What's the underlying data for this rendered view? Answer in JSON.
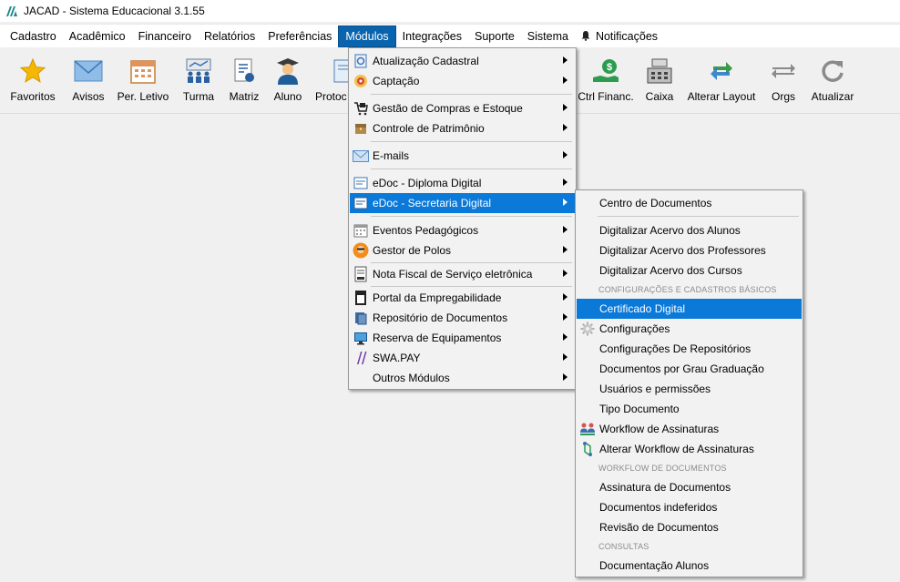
{
  "window": {
    "title": "JACAD - Sistema Educacional 3.1.55"
  },
  "menubar": {
    "items": [
      "Cadastro",
      "Acadêmico",
      "Financeiro",
      "Relatórios",
      "Preferências",
      "Módulos",
      "Integrações",
      "Suporte",
      "Sistema"
    ],
    "notifications": "Notificações"
  },
  "toolbar": {
    "items": [
      "Favoritos",
      "Avisos",
      "Per. Letivo",
      "Turma",
      "Matriz",
      "Aluno",
      "Protoc",
      "Ctrl Financ.",
      "Caixa",
      "Alterar Layout",
      "Orgs",
      "Atualizar"
    ]
  },
  "modulos_menu": {
    "items": [
      "Atualização Cadastral",
      "Captação",
      "Gestão de Compras e Estoque",
      "Controle de Patrimônio",
      "E-mails",
      "eDoc - Diploma Digital",
      "eDoc - Secretaria Digital",
      "Eventos Pedagógicos",
      "Gestor de Polos",
      "Nota Fiscal de Serviço eletrônica",
      "Portal da Empregabilidade",
      "Repositório de Documentos",
      "Reserva de Equipamentos",
      "SWA.PAY",
      "Outros Módulos"
    ]
  },
  "secretaria_submenu": {
    "items": [
      "Centro de Documentos",
      "Digitalizar Acervo dos Alunos",
      "Digitalizar Acervo dos Professores",
      "Digitalizar Acervo dos Cursos",
      "Certificado Digital",
      "Configurações",
      "Configurações De Repositórios",
      "Documentos por Grau Graduação",
      "Usuários e permissões",
      "Tipo Documento",
      "Workflow de Assinaturas",
      "Alterar Workflow de Assinaturas",
      "Assinatura de Documentos",
      "Documentos indeferidos",
      "Revisão de Documentos",
      "Documentação Alunos"
    ],
    "headers": [
      "CONFIGURAÇÕES E CADASTROS BÁSICOS",
      "WORKFLOW DE DOCUMENTOS",
      "CONSULTAS"
    ]
  },
  "colors": {
    "menu_highlight": "#0a79d8",
    "menubar_active": "#0a64ad",
    "window_bg": "#f0f0f0"
  }
}
